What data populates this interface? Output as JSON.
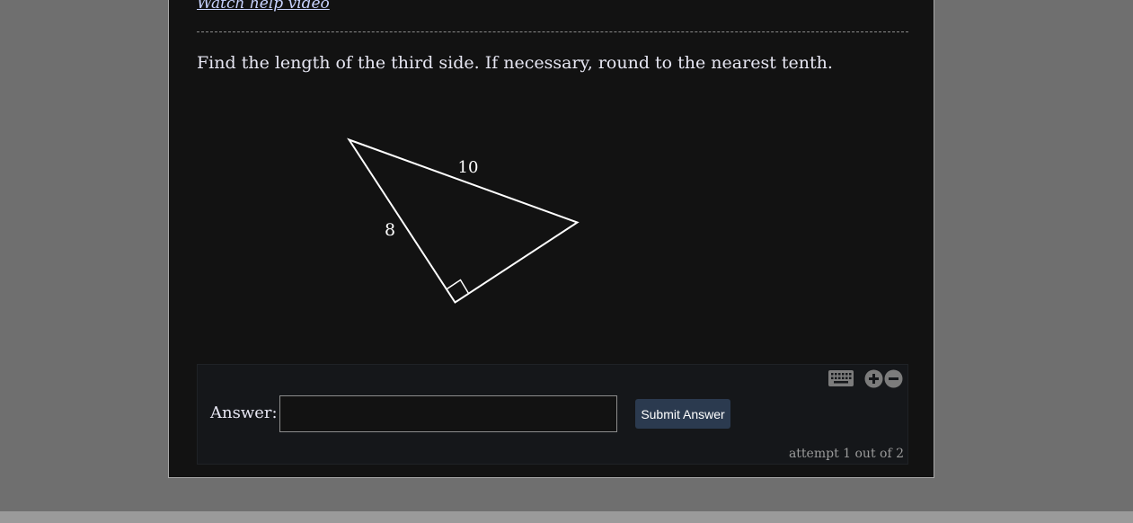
{
  "help_link": {
    "label": "Watch help video"
  },
  "question": {
    "text": "Find the length of the third side. If necessary, round to the nearest tenth."
  },
  "figure": {
    "hypotenuse_label": "10",
    "leg_label": "8",
    "right_angle_marker": true
  },
  "answer": {
    "label": "Answer:",
    "input_value": "",
    "input_placeholder": "",
    "submit_label": "Submit Answer",
    "attempt_text": "attempt 1 out of 2"
  },
  "toolbar": {
    "icons": [
      "keyboard-icon",
      "zoom-in-icon",
      "zoom-out-icon"
    ]
  },
  "colors": {
    "panel_bg": "#121212",
    "page_bg": "#6f6f6f",
    "link": "#c8d3ff",
    "button_bg": "#2b3a4f"
  }
}
